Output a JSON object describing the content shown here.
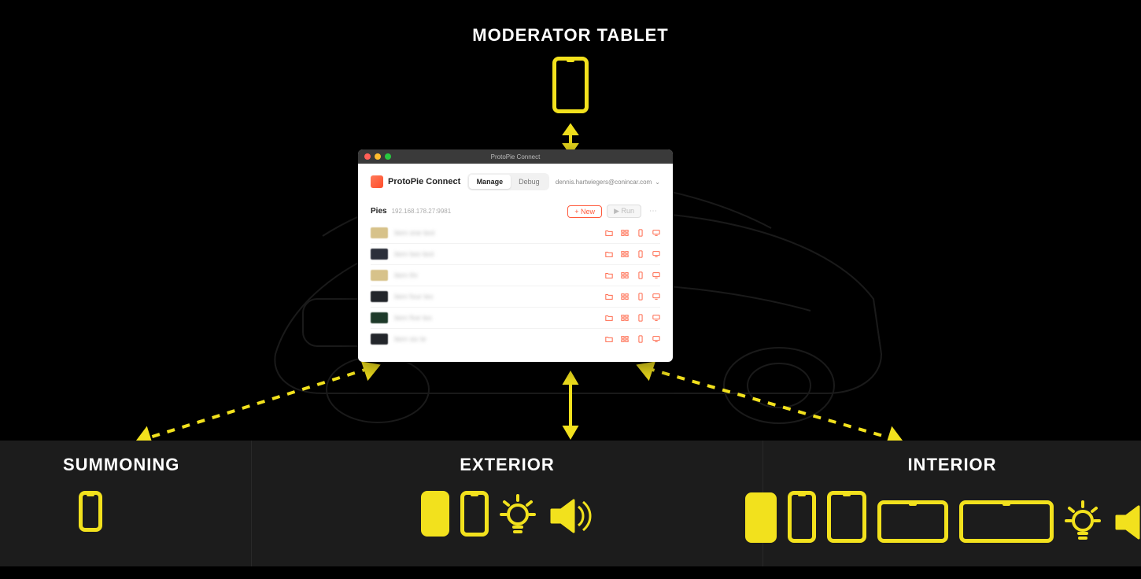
{
  "labels": {
    "top": "MODERATOR TABLET",
    "summoning": "SUMMONING",
    "exterior": "EXTERIOR",
    "interior": "INTERIOR"
  },
  "window": {
    "title": "ProtoPie Connect",
    "brand": "ProtoPie Connect",
    "tabs": {
      "manage": "Manage",
      "debug": "Debug"
    },
    "user": "dennis.hartwiegers@conincar.com",
    "pies": {
      "title": "Pies",
      "ip": "192.168.178.27:9981"
    },
    "buttons": {
      "new": "+ New",
      "run": "▶ Run"
    },
    "rows": [
      {
        "thumb": "#d7c28a",
        "name": "item one text"
      },
      {
        "thumb": "#2b2f3a",
        "name": "item two text"
      },
      {
        "thumb": "#d7c28a",
        "name": "item thr"
      },
      {
        "thumb": "#23262b",
        "name": "item four tex"
      },
      {
        "thumb": "#1e3a2a",
        "name": "item five tex"
      },
      {
        "thumb": "#23262b",
        "name": "item six te"
      }
    ]
  },
  "colors": {
    "accent": "#f2e11d"
  }
}
